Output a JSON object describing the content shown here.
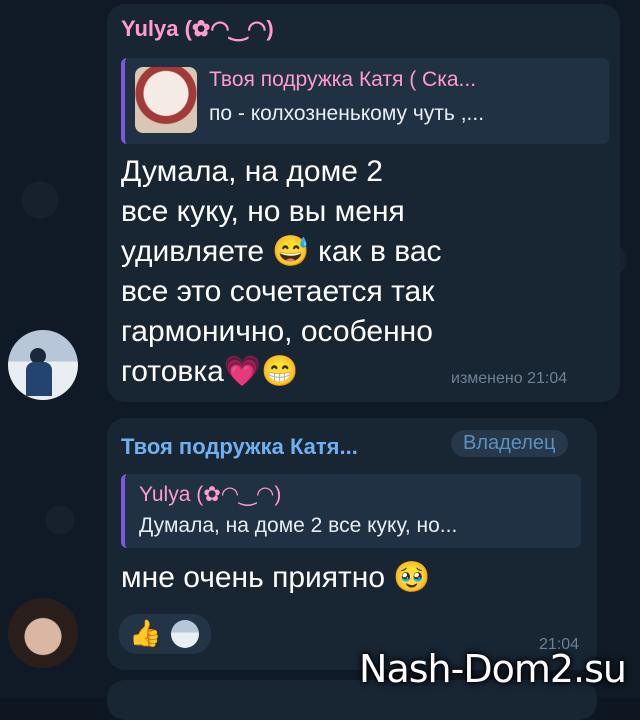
{
  "colors": {
    "background": "#101a26",
    "bubble": "#182533",
    "reply_bg": "#1f3143",
    "reply_accent": "#7d5bd6",
    "name_yulya": "#ff9bd0",
    "name_katya": "#6fb1f0",
    "badge_text": "#5e8fbd",
    "time_text": "#6e8194"
  },
  "message1": {
    "sender": "Yulya (✿◠‿◠)",
    "reply": {
      "name": "Твоя подружка Катя ( Ска...",
      "text": "по - колхозненькому чуть ,..."
    },
    "text": "Думала, на доме 2\nвсе куку, но вы меня\nудивляете 😅 как в вас\nвсе это сочетается так\nгармонично, особенно\nготовка💗😁",
    "time": "изменено 21:04"
  },
  "message2": {
    "sender": "Твоя подружка Катя...",
    "badge": "Владелец",
    "reply": {
      "name": "Yulya (✿◠‿◠)",
      "text": "Думала, на доме 2 все куку, но..."
    },
    "text": "мне очень приятно 🥹",
    "reactions": [
      {
        "emoji": "👍",
        "icon": "thumbs-up-icon"
      }
    ],
    "time": "21:04"
  },
  "watermark": "Nash-Dom2.su"
}
